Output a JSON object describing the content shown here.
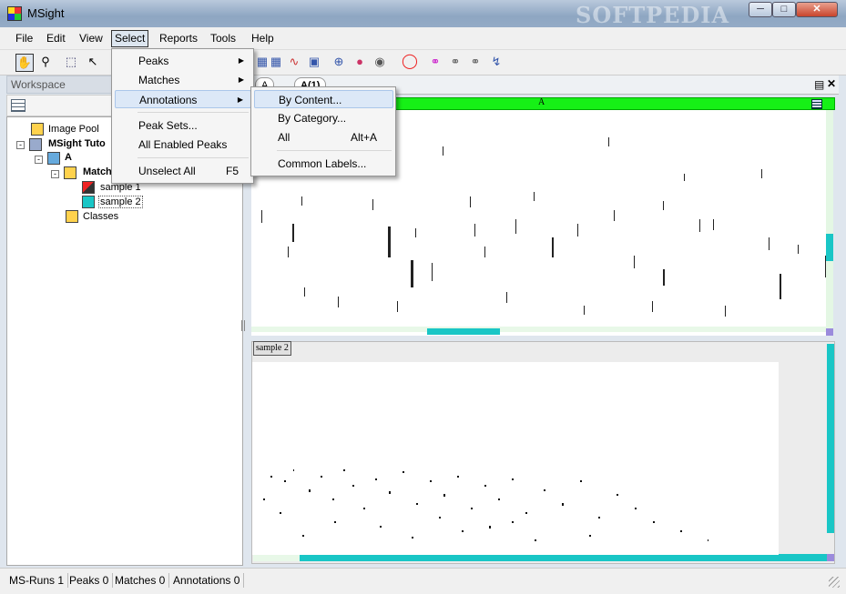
{
  "window": {
    "title": "MSight",
    "watermark": "SOFTPEDIA"
  },
  "menubar": [
    "File",
    "Edit",
    "View",
    "Select",
    "Reports",
    "Tools",
    "Help"
  ],
  "select_menu": {
    "items": [
      "Peaks",
      "Matches",
      "Annotations",
      "Peak Sets...",
      "All Enabled Peaks",
      "Unselect All"
    ],
    "unselect_accel": "F5"
  },
  "annotations_submenu": {
    "items": [
      "By Content...",
      "By Category...",
      "All",
      "Common Labels..."
    ],
    "all_accel": "Alt+A"
  },
  "workspace": {
    "title": "Workspace",
    "tree": [
      "Image Pool",
      "MSight Tuto",
      "A",
      "Match",
      "sample 1",
      "sample 2",
      "Classes"
    ]
  },
  "tabs": {
    "tab1": "A",
    "tab2": "A(1)"
  },
  "panels": {
    "panelA_title": "A",
    "panelB_label": "sample 2"
  },
  "status": [
    "MS-Runs 1",
    "Peaks 0",
    "Matches 0",
    "Annotations 0"
  ],
  "icons": [
    "hand-icon",
    "magnifier-icon",
    "select-rect-icon",
    "pointer-icon",
    "grid-icon",
    "chart-icon",
    "crosshair-icon",
    "circle-icon",
    "link-icon",
    "unlink-icon"
  ],
  "colors": {
    "panel_header": "#16f016",
    "scroll_accent": "#19c6c6"
  }
}
